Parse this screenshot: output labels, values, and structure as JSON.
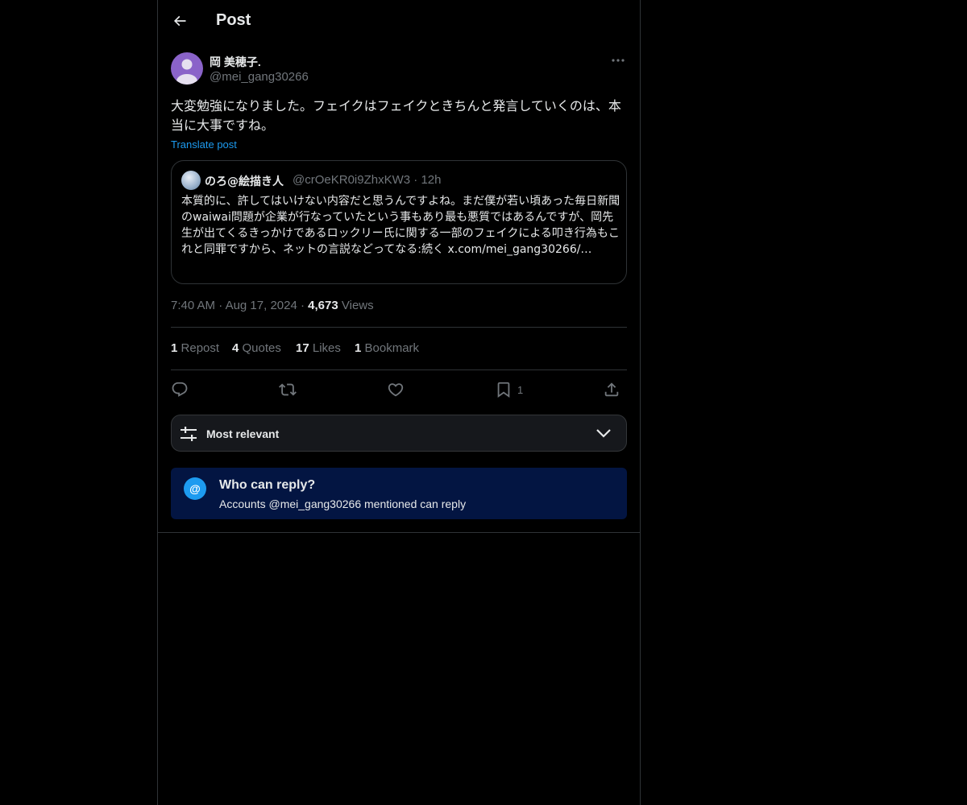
{
  "header": {
    "title": "Post",
    "back_icon": "arrow-left-icon"
  },
  "post": {
    "author_name": "岡 美穂子.",
    "author_handle": "@mei_gang30266",
    "text": "大変勉強になりました。フェイクはフェイクときちんと発言していくのは、本当に大事ですね。",
    "translate_label": "Translate post",
    "time": "7:40 AM",
    "date": "Aug 17, 2024",
    "views_count": "4,673",
    "views_label": "Views"
  },
  "quote": {
    "name": "のろ@絵描き人",
    "handle": "@crOeKR0i9ZhxKW3",
    "age": "12h",
    "text": "本質的に、許してはいけない内容だと思うんですよね。まだ僕が若い頃あった毎日新聞のwaiwai問題が企業が行なっていたという事もあり最も悪質ではあるんですが、岡先生が出てくるきっかけであるロックリー氏に関する一部のフェイクによる叩き行為もこれと同罪ですから、ネットの言説などってなる:続く x.com/mei_gang30266/…"
  },
  "stats": {
    "reposts_count": "1",
    "reposts_label": "Repost",
    "quotes_count": "4",
    "quotes_label": "Quotes",
    "likes_count": "17",
    "likes_label": "Likes",
    "bookmarks_count": "1",
    "bookmarks_label": "Bookmark"
  },
  "actions": {
    "bookmark_count": "1",
    "icons": [
      "reply-icon",
      "repost-icon",
      "like-icon",
      "bookmark-icon",
      "share-icon"
    ]
  },
  "sort": {
    "label": "Most relevant"
  },
  "reply_restriction": {
    "icon_glyph": "@",
    "title": "Who can reply?",
    "subtitle": "Accounts @mei_gang30266 mentioned can reply"
  },
  "colors": {
    "background": "#000000",
    "accent": "#1d9bf0",
    "muted_text": "#71767b",
    "border": "#2f3336",
    "reply_box_bg": "#031542"
  }
}
